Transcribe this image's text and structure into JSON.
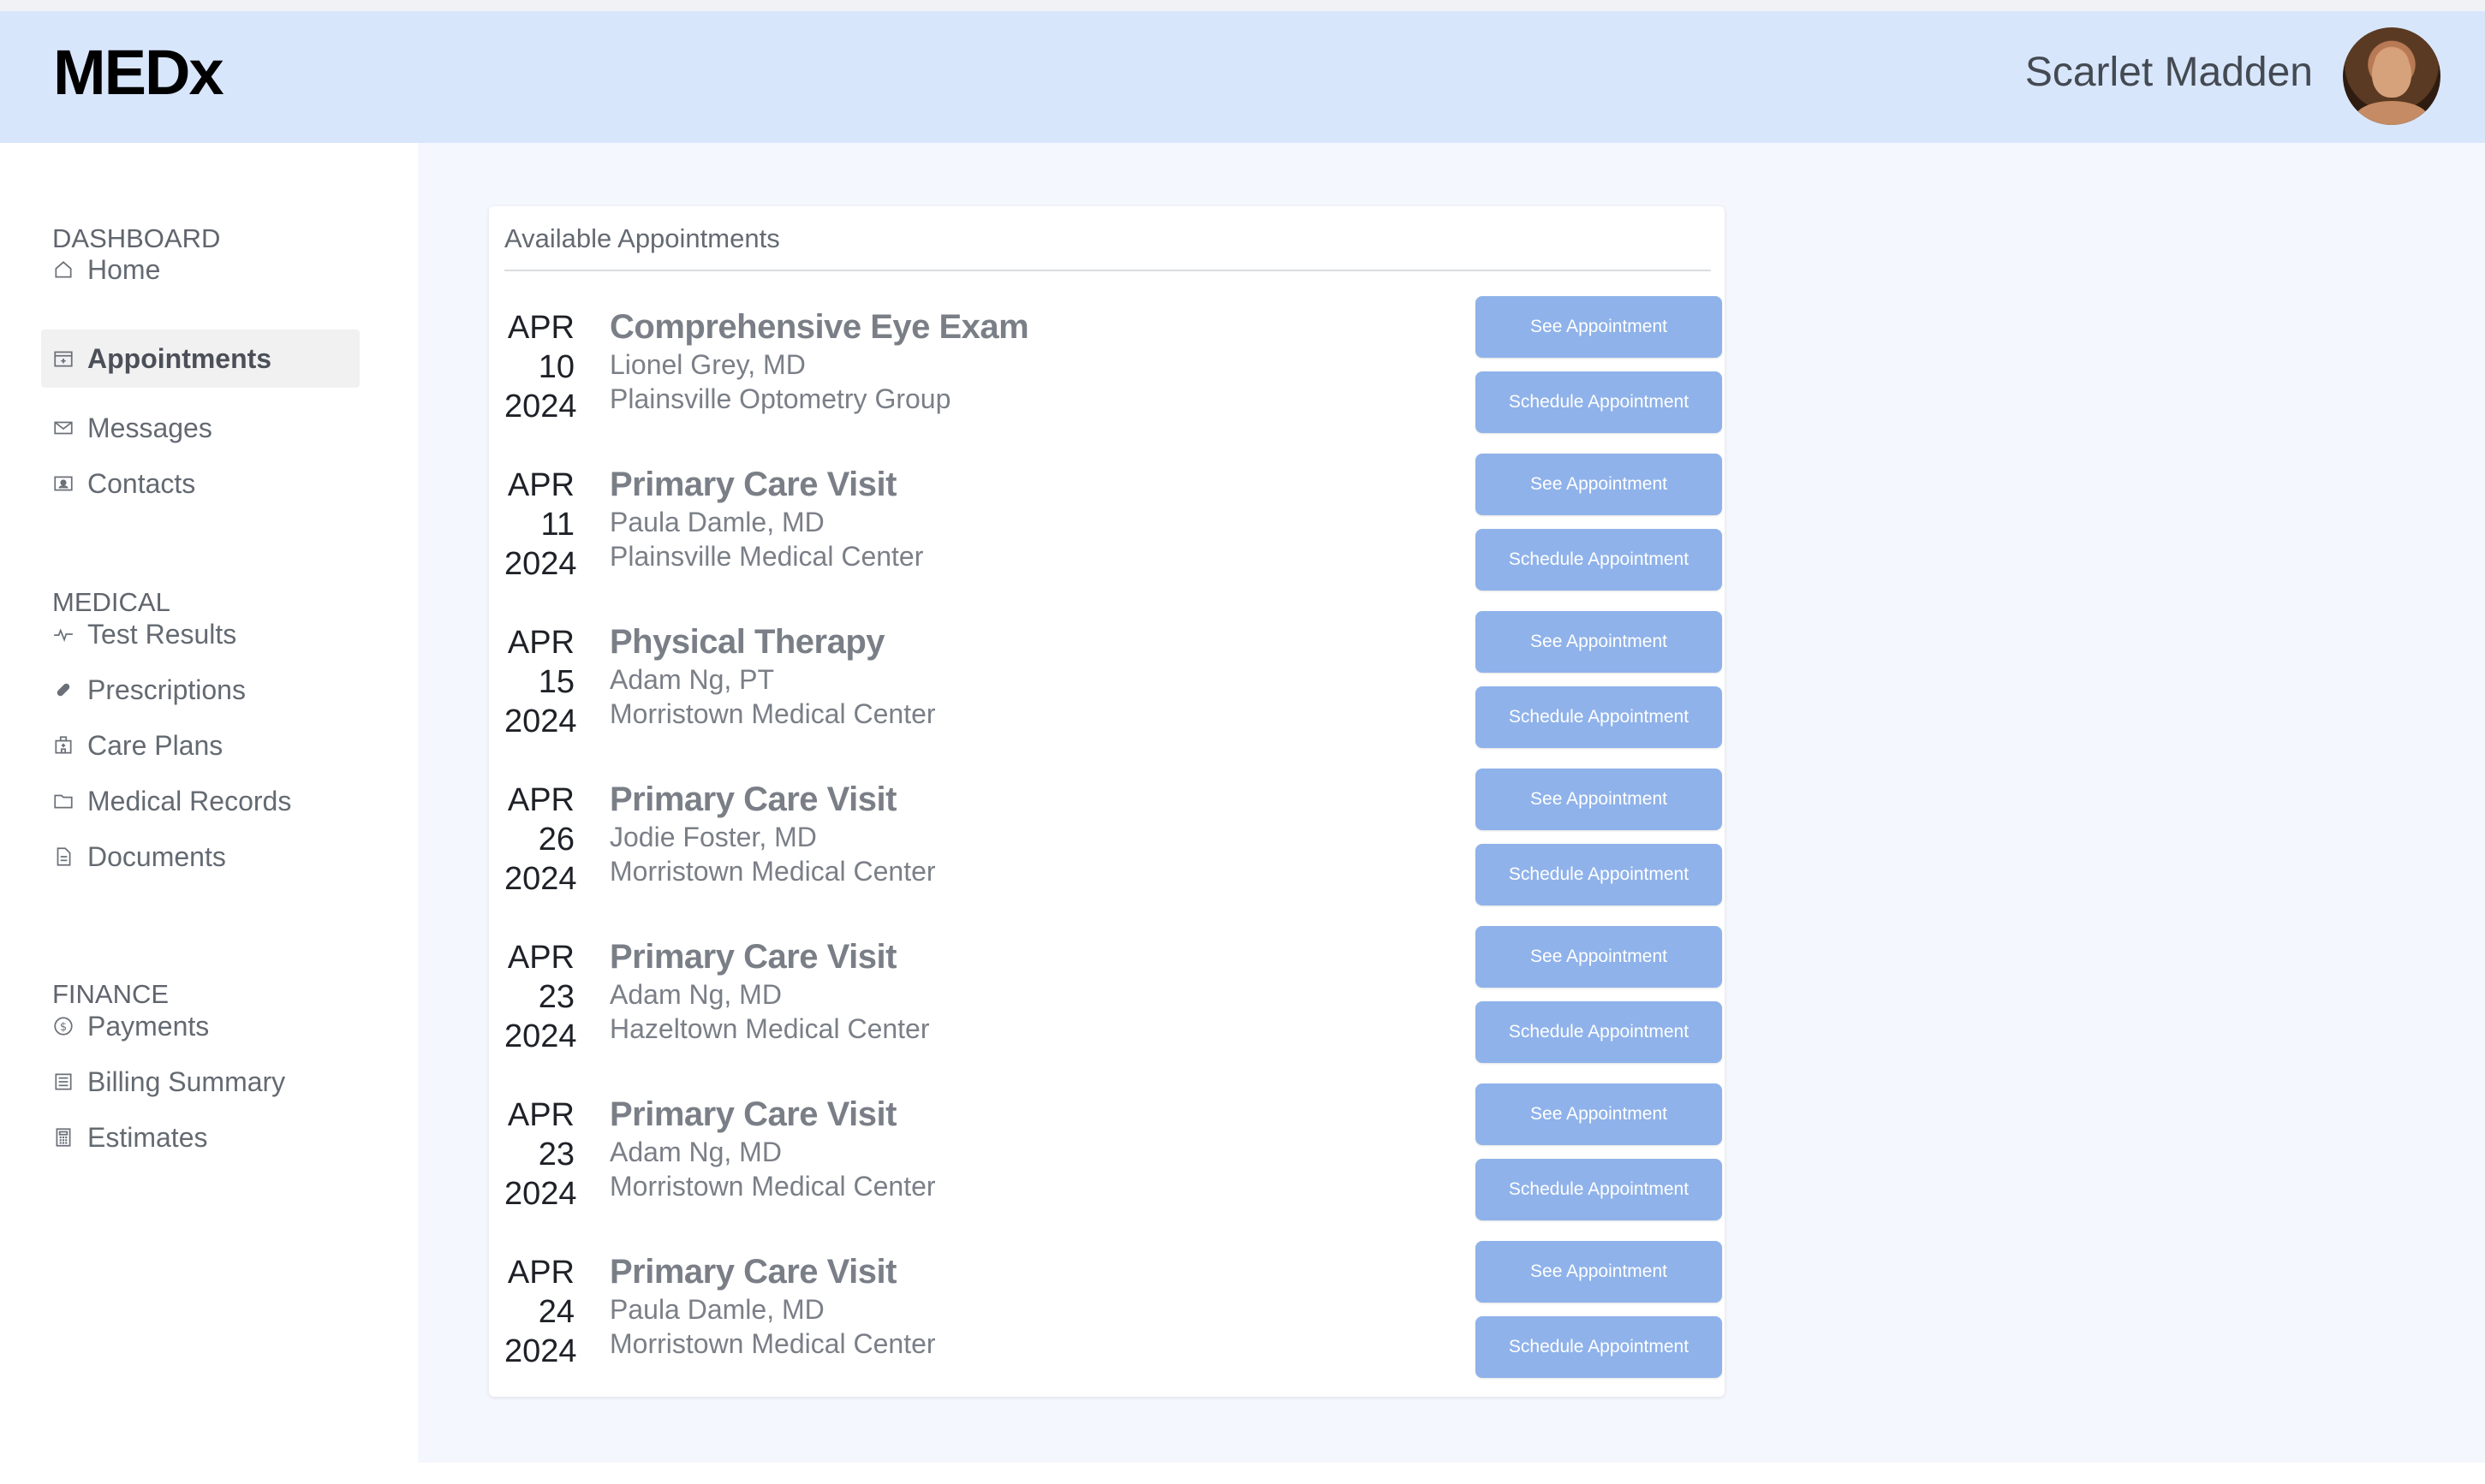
{
  "header": {
    "logo": "MEDx",
    "user_name": "Scarlet Madden"
  },
  "sidebar": {
    "sections": [
      {
        "title": "DASHBOARD",
        "items": [
          {
            "label": "Home",
            "icon": "home-icon"
          },
          {
            "label": "Appointments",
            "icon": "calendar-icon",
            "active": true
          },
          {
            "label": "Messages",
            "icon": "envelope-icon"
          },
          {
            "label": "Contacts",
            "icon": "contact-card-icon"
          }
        ]
      },
      {
        "title": "MEDICAL",
        "items": [
          {
            "label": "Test Results",
            "icon": "pulse-icon"
          },
          {
            "label": "Prescriptions",
            "icon": "pill-icon"
          },
          {
            "label": "Care Plans",
            "icon": "hospital-icon"
          },
          {
            "label": "Medical Records",
            "icon": "folder-icon"
          },
          {
            "label": "Documents",
            "icon": "document-icon"
          }
        ]
      },
      {
        "title": "FINANCE",
        "items": [
          {
            "label": "Payments",
            "icon": "dollar-coin-icon"
          },
          {
            "label": "Billing Summary",
            "icon": "billing-icon"
          },
          {
            "label": "Estimates",
            "icon": "calculator-icon"
          }
        ]
      }
    ]
  },
  "main": {
    "card_title": "Available Appointments",
    "see_label": "See Appointment",
    "schedule_label": "Schedule Appointment",
    "appointments": [
      {
        "month": "APR",
        "day": "10",
        "year": "2024",
        "title": "Comprehensive Eye Exam",
        "provider": "Lionel Grey, MD",
        "location": "Plainsville Optometry Group"
      },
      {
        "month": "APR",
        "day": "11",
        "year": "2024",
        "title": "Primary Care Visit",
        "provider": "Paula Damle, MD",
        "location": "Plainsville Medical Center"
      },
      {
        "month": "APR",
        "day": "15",
        "year": "2024",
        "title": "Physical Therapy",
        "provider": "Adam Ng, PT",
        "location": "Morristown Medical Center"
      },
      {
        "month": "APR",
        "day": "26",
        "year": "2024",
        "title": "Primary Care Visit",
        "provider": "Jodie Foster, MD",
        "location": "Morristown Medical Center"
      },
      {
        "month": "APR",
        "day": "23",
        "year": "2024",
        "title": "Primary Care Visit",
        "provider": "Adam Ng, MD",
        "location": "Hazeltown Medical Center"
      },
      {
        "month": "APR",
        "day": "23",
        "year": "2024",
        "title": "Primary Care Visit",
        "provider": "Adam Ng, MD",
        "location": "Morristown Medical Center"
      },
      {
        "month": "APR",
        "day": "24",
        "year": "2024",
        "title": "Primary Care Visit",
        "provider": "Paula Damle, MD",
        "location": "Morristown Medical Center"
      }
    ]
  },
  "colors": {
    "header_bg": "#d8e6fc",
    "main_bg": "#f4f7fd",
    "button_bg": "#8fb2ea",
    "active_nav_bg": "#f1f1f2"
  }
}
